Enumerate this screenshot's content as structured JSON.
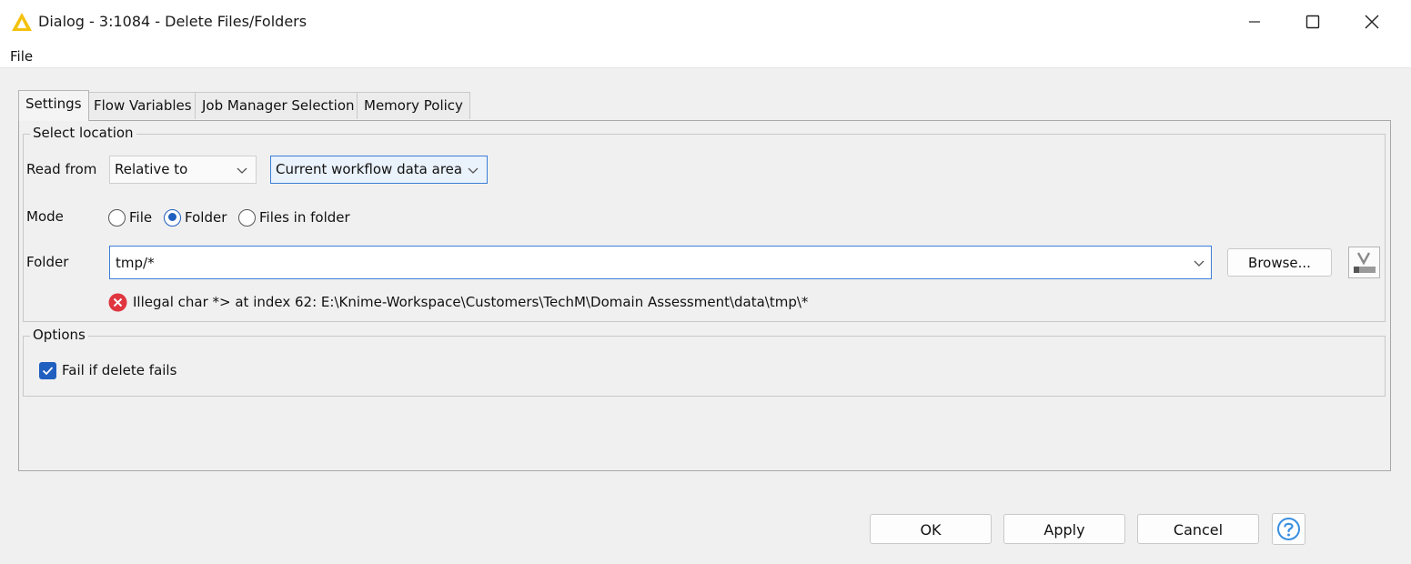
{
  "window": {
    "title": "Dialog - 3:1084 - Delete Files/Folders",
    "icon": "knime-warning-triangle-icon"
  },
  "menu": {
    "file": "File"
  },
  "tabs": [
    {
      "label": "Settings",
      "active": true
    },
    {
      "label": "Flow Variables",
      "active": false
    },
    {
      "label": "Job Manager Selection",
      "active": false
    },
    {
      "label": "Memory Policy",
      "active": false
    }
  ],
  "select_location": {
    "title": "Select location",
    "read_from_label": "Read from",
    "read_from_value": "Relative to",
    "relative_target_value": "Current workflow data area",
    "mode_label": "Mode",
    "mode_options": [
      "File",
      "Folder",
      "Files in folder"
    ],
    "mode_selected": "Folder",
    "folder_label": "Folder",
    "folder_value": "tmp/*",
    "browse_label": "Browse...",
    "error_message": "Illegal char *> at index 62: E:\\Knime-Workspace\\Customers\\TechM\\Domain Assessment\\data\\tmp\\*"
  },
  "options": {
    "title": "Options",
    "fail_if_delete_fails_label": "Fail if delete fails",
    "fail_if_delete_fails_checked": true
  },
  "footer": {
    "ok": "OK",
    "apply": "Apply",
    "cancel": "Cancel",
    "help_icon": "question-mark-icon"
  },
  "colors": {
    "accent": "#1f5fbf",
    "focus_border": "#3b7ed8",
    "error": "#e0363f",
    "warning_icon": "#f4c20d"
  }
}
